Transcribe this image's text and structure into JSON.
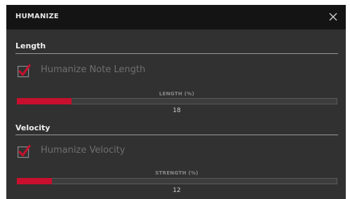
{
  "dialog": {
    "title": "HUMANIZE",
    "close_icon": "close-icon"
  },
  "length": {
    "section_title": "Length",
    "checkbox_label": "Humanize Note Length",
    "checked": true,
    "slider_caption": "LENGTH (%)",
    "value": "18",
    "fill_fraction": 0.17
  },
  "velocity": {
    "section_title": "Velocity",
    "checkbox_label": "Humanize Velocity",
    "checked": true,
    "slider_caption": "STRENGTH (%)",
    "value": "12",
    "fill_fraction": 0.11
  },
  "colors": {
    "accent": "#c8102e",
    "background": "#313131",
    "titlebar": "#141414"
  }
}
